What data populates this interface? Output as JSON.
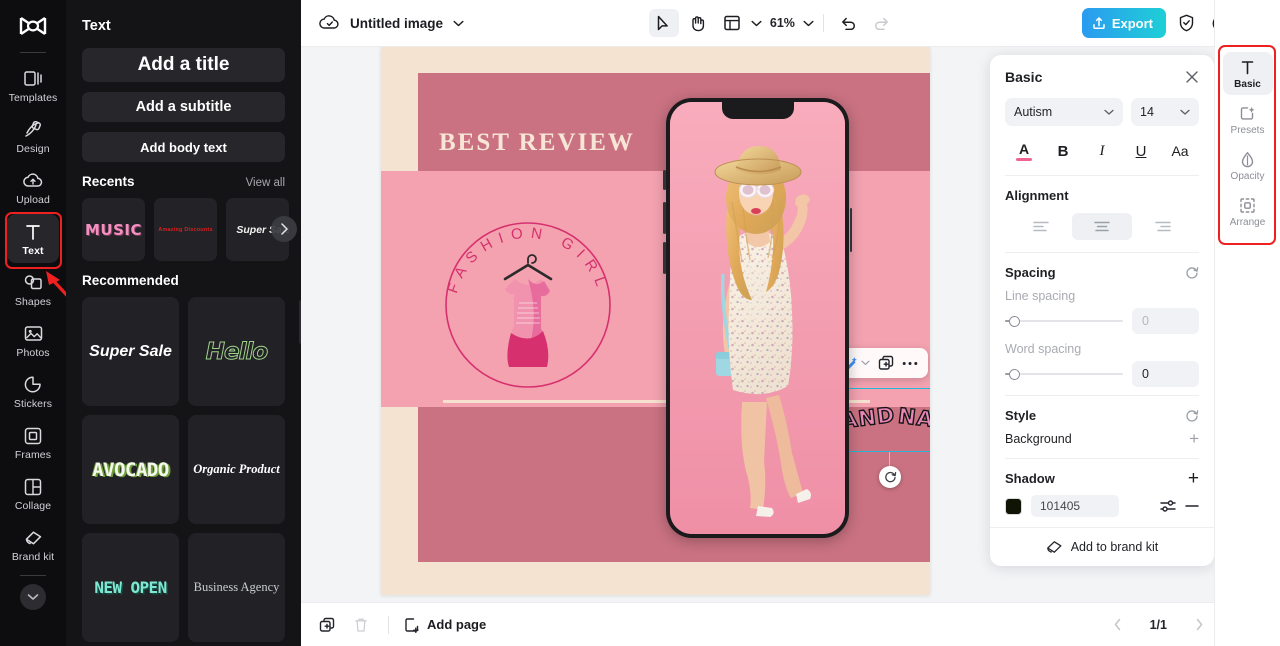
{
  "left_rail": {
    "logo_name": "capcut-logo",
    "items": [
      {
        "label": "Templates",
        "icon": "templates-icon"
      },
      {
        "label": "Design",
        "icon": "design-icon"
      },
      {
        "label": "Upload",
        "icon": "upload-icon"
      },
      {
        "label": "Text",
        "icon": "text-icon"
      },
      {
        "label": "Shapes",
        "icon": "shapes-icon"
      },
      {
        "label": "Photos",
        "icon": "photos-icon"
      },
      {
        "label": "Stickers",
        "icon": "stickers-icon"
      },
      {
        "label": "Frames",
        "icon": "frames-icon"
      },
      {
        "label": "Collage",
        "icon": "collage-icon"
      },
      {
        "label": "Brand kit",
        "icon": "brandkit-icon"
      }
    ],
    "active": "Text",
    "expand_icon": "chevron-down-icon"
  },
  "text_panel": {
    "title": "Text",
    "add_title": "Add a title",
    "add_subtitle": "Add a subtitle",
    "add_body": "Add body text",
    "recents_heading": "Recents",
    "view_all": "View all",
    "recents": [
      {
        "label": "MUSIC"
      },
      {
        "label": "Amazing Discounts"
      },
      {
        "label": "Super Sale"
      }
    ],
    "recommended_heading": "Recommended",
    "recommended": [
      {
        "label": "Super Sale"
      },
      {
        "label": "Hello"
      },
      {
        "label": "AVOCADO"
      },
      {
        "label": "Organic Product"
      },
      {
        "label": "NEW OPEN"
      },
      {
        "label": "Business Agency"
      }
    ],
    "collapse_icon": "chevron-left-icon"
  },
  "topbar": {
    "cloud_icon": "cloud-sync-icon",
    "doc_title": "Untitled image",
    "title_chevron": "chevron-down-icon",
    "select_tool": "cursor-select-icon",
    "hand_tool": "hand-pan-icon",
    "layout_tool": "layout-grid-icon",
    "zoom_value": "61%",
    "undo_icon": "undo-icon",
    "redo_icon": "redo-icon",
    "export_label": "Export",
    "shield_icon": "shield-check-icon",
    "help_icon": "question-circle-icon",
    "settings_icon": "gear-icon"
  },
  "canvas": {
    "headline": "BEST REVIEW",
    "badge_text": "FASHION GIRL",
    "brand_word_1": "BRAND",
    "brand_word_2": "NAME",
    "float_toolbar": {
      "magic_icon": "magic-wand-icon",
      "magic_chevron": "chevron-down-icon",
      "duplicate_icon": "duplicate-icon",
      "more_icon": "more-options-icon"
    },
    "rotate_icon": "rotate-handle-icon",
    "colors": {
      "paper": "#f5e3d2",
      "band": "#ca7282",
      "mid": "#f4a2b0",
      "headline": "#f7e6d6",
      "accent": "#d6316e"
    }
  },
  "bottombar": {
    "duplicate_page_icon": "duplicate-page-icon",
    "delete_page_icon": "trash-icon",
    "add_page_label": "Add page",
    "add_page_icon": "add-page-icon",
    "prev_icon": "chevron-left-icon",
    "page_indicator": "1/1",
    "next_icon": "chevron-right-icon",
    "export_page_icon": "export-page-icon"
  },
  "properties": {
    "title": "Basic",
    "close_icon": "close-icon",
    "font_family": "Autism",
    "font_size": "14",
    "format": {
      "color_label": "A",
      "bold_label": "B",
      "italic_label": "I",
      "underline_label": "U",
      "case_label": "Aa",
      "color_swatch": "#f06292"
    },
    "alignment_label": "Alignment",
    "alignment_selected": "center",
    "spacing_label": "Spacing",
    "reset_icon": "reset-icon",
    "line_spacing_label": "Line spacing",
    "line_spacing_value": "0",
    "word_spacing_label": "Word spacing",
    "word_spacing_value": "0",
    "style_label": "Style",
    "background_label": "Background",
    "shadow_label": "Shadow",
    "shadow_hex": "101405",
    "shadow_swatch": "#101405",
    "shadow_settings_icon": "sliders-icon",
    "shadow_remove_icon": "minus-icon",
    "shadow_add_icon": "plus-icon",
    "brand_kit_label": "Add to brand kit",
    "brand_kit_icon": "brandkit-icon"
  },
  "right_rail": {
    "items": [
      {
        "label": "Basic",
        "icon": "text-basic-icon"
      },
      {
        "label": "Presets",
        "icon": "presets-icon"
      },
      {
        "label": "Opacity",
        "icon": "opacity-drop-icon"
      },
      {
        "label": "Arrange",
        "icon": "arrange-icon"
      }
    ],
    "active": "Basic"
  },
  "annotations": {
    "highlight_color": "#ef2020",
    "arrow_icon": "pointer-arrow-annotation"
  }
}
